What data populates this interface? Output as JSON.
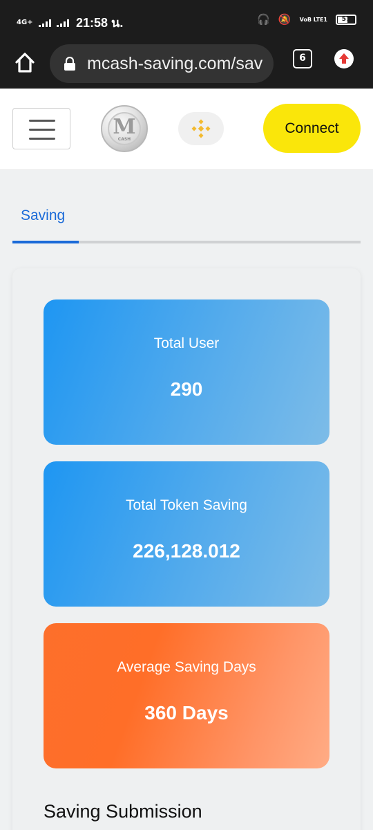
{
  "status_bar": {
    "network": "4G+",
    "time": "21:58 น.",
    "volte": "VoB LTE1",
    "battery": "57"
  },
  "browser": {
    "url": "mcash-saving.com/sav",
    "tab_count": "6"
  },
  "header": {
    "logo_letter": "M",
    "logo_subtext": "CASH",
    "connect_label": "Connect"
  },
  "tabs": [
    {
      "label": "Saving",
      "active": true
    }
  ],
  "stats": [
    {
      "label": "Total User",
      "value": "290"
    },
    {
      "label": "Total Token Saving",
      "value": "226,128.012"
    },
    {
      "label": "Average Saving Days",
      "value": "360 Days"
    }
  ],
  "section": {
    "title": "Saving Submission"
  },
  "colors": {
    "accent": "#1a6ad8",
    "connect": "#fae60a",
    "binance": "#f3ba2f",
    "stat_blue": "#1e96f2",
    "stat_orange": "#ff6e28"
  }
}
